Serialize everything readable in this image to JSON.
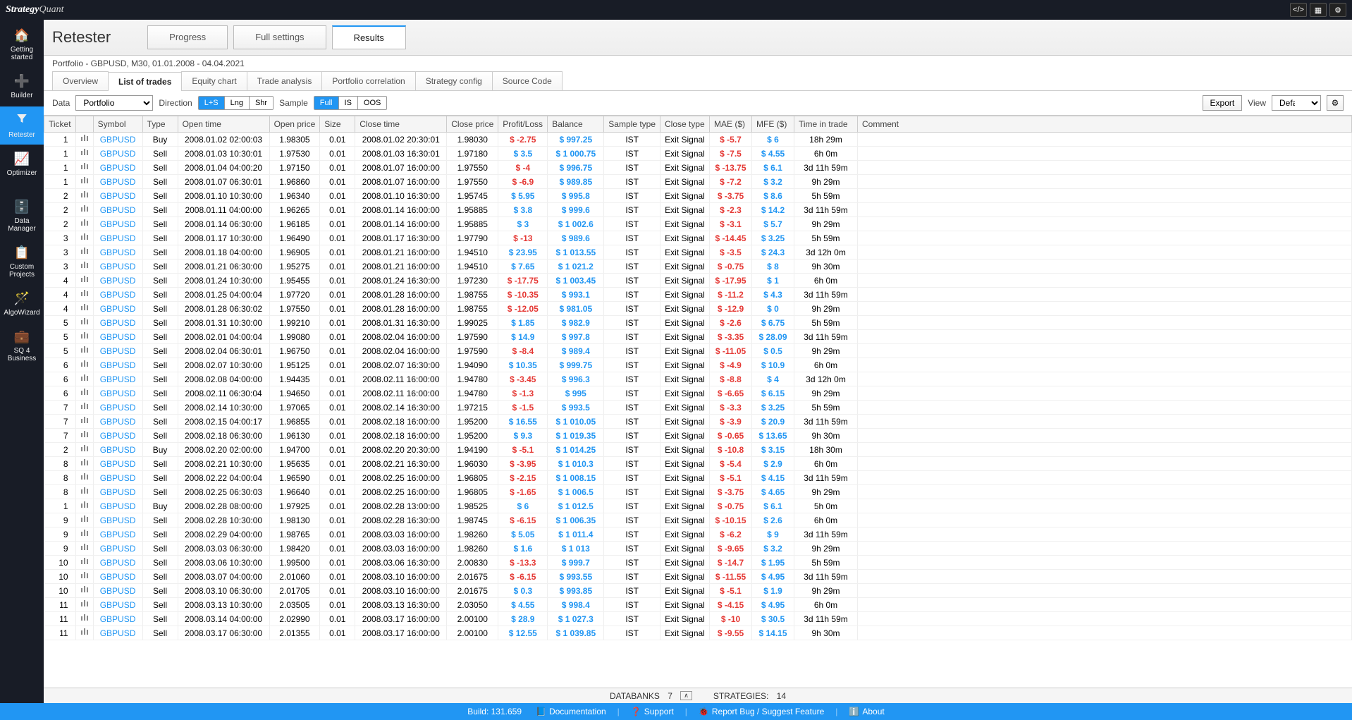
{
  "app": {
    "logo_strategy": "Strategy",
    "logo_quant": "Quant"
  },
  "nav": {
    "items": [
      {
        "icon": "🏠",
        "label": "Getting started"
      },
      {
        "icon": "➕",
        "label": "Builder"
      },
      {
        "icon": "▼",
        "label": "Retester",
        "active": true,
        "funnel": true
      },
      {
        "icon": "📈",
        "label": "Optimizer"
      },
      {
        "icon": "🗄️",
        "label": "Data Manager",
        "gap": true
      },
      {
        "icon": "📋",
        "label": "Custom Projects"
      },
      {
        "icon": "🪄",
        "label": "AlgoWizard"
      },
      {
        "icon": "💼",
        "label": "SQ 4 Business"
      }
    ]
  },
  "header": {
    "title": "Retester",
    "tabs": [
      {
        "label": "Progress"
      },
      {
        "label": "Full settings"
      },
      {
        "label": "Results",
        "active": true
      }
    ]
  },
  "subtitle": "Portfolio - GBPUSD, M30, 01.01.2008 - 04.04.2021",
  "subtabs": [
    {
      "label": "Overview"
    },
    {
      "label": "List of trades",
      "active": true
    },
    {
      "label": "Equity chart"
    },
    {
      "label": "Trade analysis"
    },
    {
      "label": "Portfolio correlation"
    },
    {
      "label": "Strategy config"
    },
    {
      "label": "Source Code"
    }
  ],
  "filters": {
    "data_label": "Data",
    "data_value": "Portfolio",
    "direction_label": "Direction",
    "direction": [
      {
        "l": "L+S",
        "a": true
      },
      {
        "l": "Lng"
      },
      {
        "l": "Shr"
      }
    ],
    "sample_label": "Sample",
    "sample": [
      {
        "l": "Full",
        "a": true
      },
      {
        "l": "IS"
      },
      {
        "l": "OOS"
      }
    ],
    "export": "Export",
    "view": "View",
    "view_value": "Default"
  },
  "columns": [
    "Ticket",
    "",
    "Symbol",
    "Type",
    "Open time",
    "Open price",
    "Size",
    "Close time",
    "Close price",
    "Profit/Loss",
    "Balance",
    "Sample type",
    "Close type",
    "MAE ($)",
    "MFE ($)",
    "Time in trade",
    "Comment"
  ],
  "rows": [
    {
      "t": 1,
      "sym": "GBPUSD",
      "type": "Buy",
      "ot": "2008.01.02 02:00:03",
      "op": "1.98305",
      "sz": "0.01",
      "ct": "2008.01.02 20:30:01",
      "cp": "1.98030",
      "pl": "$ -2.75",
      "bal": "$ 997.25",
      "st": "IST",
      "cl": "Exit Signal",
      "mae": "$ -5.7",
      "mfe": "$ 6",
      "tt": "18h 29m"
    },
    {
      "t": 1,
      "sym": "GBPUSD",
      "type": "Sell",
      "ot": "2008.01.03 10:30:01",
      "op": "1.97530",
      "sz": "0.01",
      "ct": "2008.01.03 16:30:01",
      "cp": "1.97180",
      "pl": "$ 3.5",
      "bal": "$ 1 000.75",
      "st": "IST",
      "cl": "Exit Signal",
      "mae": "$ -7.5",
      "mfe": "$ 4.55",
      "tt": "6h 0m"
    },
    {
      "t": 1,
      "sym": "GBPUSD",
      "type": "Sell",
      "ot": "2008.01.04 04:00:20",
      "op": "1.97150",
      "sz": "0.01",
      "ct": "2008.01.07 16:00:00",
      "cp": "1.97550",
      "pl": "$ -4",
      "bal": "$ 996.75",
      "st": "IST",
      "cl": "Exit Signal",
      "mae": "$ -13.75",
      "mfe": "$ 6.1",
      "tt": "3d 11h 59m"
    },
    {
      "t": 1,
      "sym": "GBPUSD",
      "type": "Sell",
      "ot": "2008.01.07 06:30:01",
      "op": "1.96860",
      "sz": "0.01",
      "ct": "2008.01.07 16:00:00",
      "cp": "1.97550",
      "pl": "$ -6.9",
      "bal": "$ 989.85",
      "st": "IST",
      "cl": "Exit Signal",
      "mae": "$ -7.2",
      "mfe": "$ 3.2",
      "tt": "9h 29m"
    },
    {
      "t": 2,
      "sym": "GBPUSD",
      "type": "Sell",
      "ot": "2008.01.10 10:30:00",
      "op": "1.96340",
      "sz": "0.01",
      "ct": "2008.01.10 16:30:00",
      "cp": "1.95745",
      "pl": "$ 5.95",
      "bal": "$ 995.8",
      "st": "IST",
      "cl": "Exit Signal",
      "mae": "$ -3.75",
      "mfe": "$ 8.6",
      "tt": "5h 59m"
    },
    {
      "t": 2,
      "sym": "GBPUSD",
      "type": "Sell",
      "ot": "2008.01.11 04:00:00",
      "op": "1.96265",
      "sz": "0.01",
      "ct": "2008.01.14 16:00:00",
      "cp": "1.95885",
      "pl": "$ 3.8",
      "bal": "$ 999.6",
      "st": "IST",
      "cl": "Exit Signal",
      "mae": "$ -2.3",
      "mfe": "$ 14.2",
      "tt": "3d 11h 59m"
    },
    {
      "t": 2,
      "sym": "GBPUSD",
      "type": "Sell",
      "ot": "2008.01.14 06:30:00",
      "op": "1.96185",
      "sz": "0.01",
      "ct": "2008.01.14 16:00:00",
      "cp": "1.95885",
      "pl": "$ 3",
      "bal": "$ 1 002.6",
      "st": "IST",
      "cl": "Exit Signal",
      "mae": "$ -3.1",
      "mfe": "$ 5.7",
      "tt": "9h 29m"
    },
    {
      "t": 3,
      "sym": "GBPUSD",
      "type": "Sell",
      "ot": "2008.01.17 10:30:00",
      "op": "1.96490",
      "sz": "0.01",
      "ct": "2008.01.17 16:30:00",
      "cp": "1.97790",
      "pl": "$ -13",
      "bal": "$ 989.6",
      "st": "IST",
      "cl": "Exit Signal",
      "mae": "$ -14.45",
      "mfe": "$ 3.25",
      "tt": "5h 59m"
    },
    {
      "t": 3,
      "sym": "GBPUSD",
      "type": "Sell",
      "ot": "2008.01.18 04:00:00",
      "op": "1.96905",
      "sz": "0.01",
      "ct": "2008.01.21 16:00:00",
      "cp": "1.94510",
      "pl": "$ 23.95",
      "bal": "$ 1 013.55",
      "st": "IST",
      "cl": "Exit Signal",
      "mae": "$ -3.5",
      "mfe": "$ 24.3",
      "tt": "3d 12h 0m"
    },
    {
      "t": 3,
      "sym": "GBPUSD",
      "type": "Sell",
      "ot": "2008.01.21 06:30:00",
      "op": "1.95275",
      "sz": "0.01",
      "ct": "2008.01.21 16:00:00",
      "cp": "1.94510",
      "pl": "$ 7.65",
      "bal": "$ 1 021.2",
      "st": "IST",
      "cl": "Exit Signal",
      "mae": "$ -0.75",
      "mfe": "$ 8",
      "tt": "9h 30m"
    },
    {
      "t": 4,
      "sym": "GBPUSD",
      "type": "Sell",
      "ot": "2008.01.24 10:30:00",
      "op": "1.95455",
      "sz": "0.01",
      "ct": "2008.01.24 16:30:00",
      "cp": "1.97230",
      "pl": "$ -17.75",
      "bal": "$ 1 003.45",
      "st": "IST",
      "cl": "Exit Signal",
      "mae": "$ -17.95",
      "mfe": "$ 1",
      "tt": "6h 0m"
    },
    {
      "t": 4,
      "sym": "GBPUSD",
      "type": "Sell",
      "ot": "2008.01.25 04:00:04",
      "op": "1.97720",
      "sz": "0.01",
      "ct": "2008.01.28 16:00:00",
      "cp": "1.98755",
      "pl": "$ -10.35",
      "bal": "$ 993.1",
      "st": "IST",
      "cl": "Exit Signal",
      "mae": "$ -11.2",
      "mfe": "$ 4.3",
      "tt": "3d 11h 59m"
    },
    {
      "t": 4,
      "sym": "GBPUSD",
      "type": "Sell",
      "ot": "2008.01.28 06:30:02",
      "op": "1.97550",
      "sz": "0.01",
      "ct": "2008.01.28 16:00:00",
      "cp": "1.98755",
      "pl": "$ -12.05",
      "bal": "$ 981.05",
      "st": "IST",
      "cl": "Exit Signal",
      "mae": "$ -12.9",
      "mfe": "$ 0",
      "tt": "9h 29m"
    },
    {
      "t": 5,
      "sym": "GBPUSD",
      "type": "Sell",
      "ot": "2008.01.31 10:30:00",
      "op": "1.99210",
      "sz": "0.01",
      "ct": "2008.01.31 16:30:00",
      "cp": "1.99025",
      "pl": "$ 1.85",
      "bal": "$ 982.9",
      "st": "IST",
      "cl": "Exit Signal",
      "mae": "$ -2.6",
      "mfe": "$ 6.75",
      "tt": "5h 59m"
    },
    {
      "t": 5,
      "sym": "GBPUSD",
      "type": "Sell",
      "ot": "2008.02.01 04:00:04",
      "op": "1.99080",
      "sz": "0.01",
      "ct": "2008.02.04 16:00:00",
      "cp": "1.97590",
      "pl": "$ 14.9",
      "bal": "$ 997.8",
      "st": "IST",
      "cl": "Exit Signal",
      "mae": "$ -3.35",
      "mfe": "$ 28.09",
      "tt": "3d 11h 59m"
    },
    {
      "t": 5,
      "sym": "GBPUSD",
      "type": "Sell",
      "ot": "2008.02.04 06:30:01",
      "op": "1.96750",
      "sz": "0.01",
      "ct": "2008.02.04 16:00:00",
      "cp": "1.97590",
      "pl": "$ -8.4",
      "bal": "$ 989.4",
      "st": "IST",
      "cl": "Exit Signal",
      "mae": "$ -11.05",
      "mfe": "$ 0.5",
      "tt": "9h 29m"
    },
    {
      "t": 6,
      "sym": "GBPUSD",
      "type": "Sell",
      "ot": "2008.02.07 10:30:00",
      "op": "1.95125",
      "sz": "0.01",
      "ct": "2008.02.07 16:30:00",
      "cp": "1.94090",
      "pl": "$ 10.35",
      "bal": "$ 999.75",
      "st": "IST",
      "cl": "Exit Signal",
      "mae": "$ -4.9",
      "mfe": "$ 10.9",
      "tt": "6h 0m"
    },
    {
      "t": 6,
      "sym": "GBPUSD",
      "type": "Sell",
      "ot": "2008.02.08 04:00:00",
      "op": "1.94435",
      "sz": "0.01",
      "ct": "2008.02.11 16:00:00",
      "cp": "1.94780",
      "pl": "$ -3.45",
      "bal": "$ 996.3",
      "st": "IST",
      "cl": "Exit Signal",
      "mae": "$ -8.8",
      "mfe": "$ 4",
      "tt": "3d 12h 0m"
    },
    {
      "t": 6,
      "sym": "GBPUSD",
      "type": "Sell",
      "ot": "2008.02.11 06:30:04",
      "op": "1.94650",
      "sz": "0.01",
      "ct": "2008.02.11 16:00:00",
      "cp": "1.94780",
      "pl": "$ -1.3",
      "bal": "$ 995",
      "st": "IST",
      "cl": "Exit Signal",
      "mae": "$ -6.65",
      "mfe": "$ 6.15",
      "tt": "9h 29m"
    },
    {
      "t": 7,
      "sym": "GBPUSD",
      "type": "Sell",
      "ot": "2008.02.14 10:30:00",
      "op": "1.97065",
      "sz": "0.01",
      "ct": "2008.02.14 16:30:00",
      "cp": "1.97215",
      "pl": "$ -1.5",
      "bal": "$ 993.5",
      "st": "IST",
      "cl": "Exit Signal",
      "mae": "$ -3.3",
      "mfe": "$ 3.25",
      "tt": "5h 59m"
    },
    {
      "t": 7,
      "sym": "GBPUSD",
      "type": "Sell",
      "ot": "2008.02.15 04:00:17",
      "op": "1.96855",
      "sz": "0.01",
      "ct": "2008.02.18 16:00:00",
      "cp": "1.95200",
      "pl": "$ 16.55",
      "bal": "$ 1 010.05",
      "st": "IST",
      "cl": "Exit Signal",
      "mae": "$ -3.9",
      "mfe": "$ 20.9",
      "tt": "3d 11h 59m"
    },
    {
      "t": 7,
      "sym": "GBPUSD",
      "type": "Sell",
      "ot": "2008.02.18 06:30:00",
      "op": "1.96130",
      "sz": "0.01",
      "ct": "2008.02.18 16:00:00",
      "cp": "1.95200",
      "pl": "$ 9.3",
      "bal": "$ 1 019.35",
      "st": "IST",
      "cl": "Exit Signal",
      "mae": "$ -0.65",
      "mfe": "$ 13.65",
      "tt": "9h 30m"
    },
    {
      "t": 2,
      "sym": "GBPUSD",
      "type": "Buy",
      "ot": "2008.02.20 02:00:00",
      "op": "1.94700",
      "sz": "0.01",
      "ct": "2008.02.20 20:30:00",
      "cp": "1.94190",
      "pl": "$ -5.1",
      "bal": "$ 1 014.25",
      "st": "IST",
      "cl": "Exit Signal",
      "mae": "$ -10.8",
      "mfe": "$ 3.15",
      "tt": "18h 30m"
    },
    {
      "t": 8,
      "sym": "GBPUSD",
      "type": "Sell",
      "ot": "2008.02.21 10:30:00",
      "op": "1.95635",
      "sz": "0.01",
      "ct": "2008.02.21 16:30:00",
      "cp": "1.96030",
      "pl": "$ -3.95",
      "bal": "$ 1 010.3",
      "st": "IST",
      "cl": "Exit Signal",
      "mae": "$ -5.4",
      "mfe": "$ 2.9",
      "tt": "6h 0m"
    },
    {
      "t": 8,
      "sym": "GBPUSD",
      "type": "Sell",
      "ot": "2008.02.22 04:00:04",
      "op": "1.96590",
      "sz": "0.01",
      "ct": "2008.02.25 16:00:00",
      "cp": "1.96805",
      "pl": "$ -2.15",
      "bal": "$ 1 008.15",
      "st": "IST",
      "cl": "Exit Signal",
      "mae": "$ -5.1",
      "mfe": "$ 4.15",
      "tt": "3d 11h 59m"
    },
    {
      "t": 8,
      "sym": "GBPUSD",
      "type": "Sell",
      "ot": "2008.02.25 06:30:03",
      "op": "1.96640",
      "sz": "0.01",
      "ct": "2008.02.25 16:00:00",
      "cp": "1.96805",
      "pl": "$ -1.65",
      "bal": "$ 1 006.5",
      "st": "IST",
      "cl": "Exit Signal",
      "mae": "$ -3.75",
      "mfe": "$ 4.65",
      "tt": "9h 29m"
    },
    {
      "t": 1,
      "sym": "GBPUSD",
      "type": "Buy",
      "ot": "2008.02.28 08:00:00",
      "op": "1.97925",
      "sz": "0.01",
      "ct": "2008.02.28 13:00:00",
      "cp": "1.98525",
      "pl": "$ 6",
      "bal": "$ 1 012.5",
      "st": "IST",
      "cl": "Exit Signal",
      "mae": "$ -0.75",
      "mfe": "$ 6.1",
      "tt": "5h 0m"
    },
    {
      "t": 9,
      "sym": "GBPUSD",
      "type": "Sell",
      "ot": "2008.02.28 10:30:00",
      "op": "1.98130",
      "sz": "0.01",
      "ct": "2008.02.28 16:30:00",
      "cp": "1.98745",
      "pl": "$ -6.15",
      "bal": "$ 1 006.35",
      "st": "IST",
      "cl": "Exit Signal",
      "mae": "$ -10.15",
      "mfe": "$ 2.6",
      "tt": "6h 0m"
    },
    {
      "t": 9,
      "sym": "GBPUSD",
      "type": "Sell",
      "ot": "2008.02.29 04:00:00",
      "op": "1.98765",
      "sz": "0.01",
      "ct": "2008.03.03 16:00:00",
      "cp": "1.98260",
      "pl": "$ 5.05",
      "bal": "$ 1 011.4",
      "st": "IST",
      "cl": "Exit Signal",
      "mae": "$ -6.2",
      "mfe": "$ 9",
      "tt": "3d 11h 59m"
    },
    {
      "t": 9,
      "sym": "GBPUSD",
      "type": "Sell",
      "ot": "2008.03.03 06:30:00",
      "op": "1.98420",
      "sz": "0.01",
      "ct": "2008.03.03 16:00:00",
      "cp": "1.98260",
      "pl": "$ 1.6",
      "bal": "$ 1 013",
      "st": "IST",
      "cl": "Exit Signal",
      "mae": "$ -9.65",
      "mfe": "$ 3.2",
      "tt": "9h 29m"
    },
    {
      "t": 10,
      "sym": "GBPUSD",
      "type": "Sell",
      "ot": "2008.03.06 10:30:00",
      "op": "1.99500",
      "sz": "0.01",
      "ct": "2008.03.06 16:30:00",
      "cp": "2.00830",
      "pl": "$ -13.3",
      "bal": "$ 999.7",
      "st": "IST",
      "cl": "Exit Signal",
      "mae": "$ -14.7",
      "mfe": "$ 1.95",
      "tt": "5h 59m"
    },
    {
      "t": 10,
      "sym": "GBPUSD",
      "type": "Sell",
      "ot": "2008.03.07 04:00:00",
      "op": "2.01060",
      "sz": "0.01",
      "ct": "2008.03.10 16:00:00",
      "cp": "2.01675",
      "pl": "$ -6.15",
      "bal": "$ 993.55",
      "st": "IST",
      "cl": "Exit Signal",
      "mae": "$ -11.55",
      "mfe": "$ 4.95",
      "tt": "3d 11h 59m"
    },
    {
      "t": 10,
      "sym": "GBPUSD",
      "type": "Sell",
      "ot": "2008.03.10 06:30:00",
      "op": "2.01705",
      "sz": "0.01",
      "ct": "2008.03.10 16:00:00",
      "cp": "2.01675",
      "pl": "$ 0.3",
      "bal": "$ 993.85",
      "st": "IST",
      "cl": "Exit Signal",
      "mae": "$ -5.1",
      "mfe": "$ 1.9",
      "tt": "9h 29m"
    },
    {
      "t": 11,
      "sym": "GBPUSD",
      "type": "Sell",
      "ot": "2008.03.13 10:30:00",
      "op": "2.03505",
      "sz": "0.01",
      "ct": "2008.03.13 16:30:00",
      "cp": "2.03050",
      "pl": "$ 4.55",
      "bal": "$ 998.4",
      "st": "IST",
      "cl": "Exit Signal",
      "mae": "$ -4.15",
      "mfe": "$ 4.95",
      "tt": "6h 0m"
    },
    {
      "t": 11,
      "sym": "GBPUSD",
      "type": "Sell",
      "ot": "2008.03.14 04:00:00",
      "op": "2.02990",
      "sz": "0.01",
      "ct": "2008.03.17 16:00:00",
      "cp": "2.00100",
      "pl": "$ 28.9",
      "bal": "$ 1 027.3",
      "st": "IST",
      "cl": "Exit Signal",
      "mae": "$ -10",
      "mfe": "$ 30.5",
      "tt": "3d 11h 59m"
    },
    {
      "t": 11,
      "sym": "GBPUSD",
      "type": "Sell",
      "ot": "2008.03.17 06:30:00",
      "op": "2.01355",
      "sz": "0.01",
      "ct": "2008.03.17 16:00:00",
      "cp": "2.00100",
      "pl": "$ 12.55",
      "bal": "$ 1 039.85",
      "st": "IST",
      "cl": "Exit Signal",
      "mae": "$ -9.55",
      "mfe": "$ 14.15",
      "tt": "9h 30m"
    }
  ],
  "status": {
    "databanks_label": "DATABANKS",
    "databanks": "7",
    "strategies_label": "STRATEGIES:",
    "strategies": "14"
  },
  "footer": {
    "build": "Build: 131.659",
    "links": [
      {
        "icon": "📘",
        "label": "Documentation"
      },
      {
        "icon": "❓",
        "label": "Support"
      },
      {
        "icon": "🐞",
        "label": "Report Bug / Suggest Feature"
      },
      {
        "icon": "ℹ️",
        "label": "About"
      }
    ]
  }
}
